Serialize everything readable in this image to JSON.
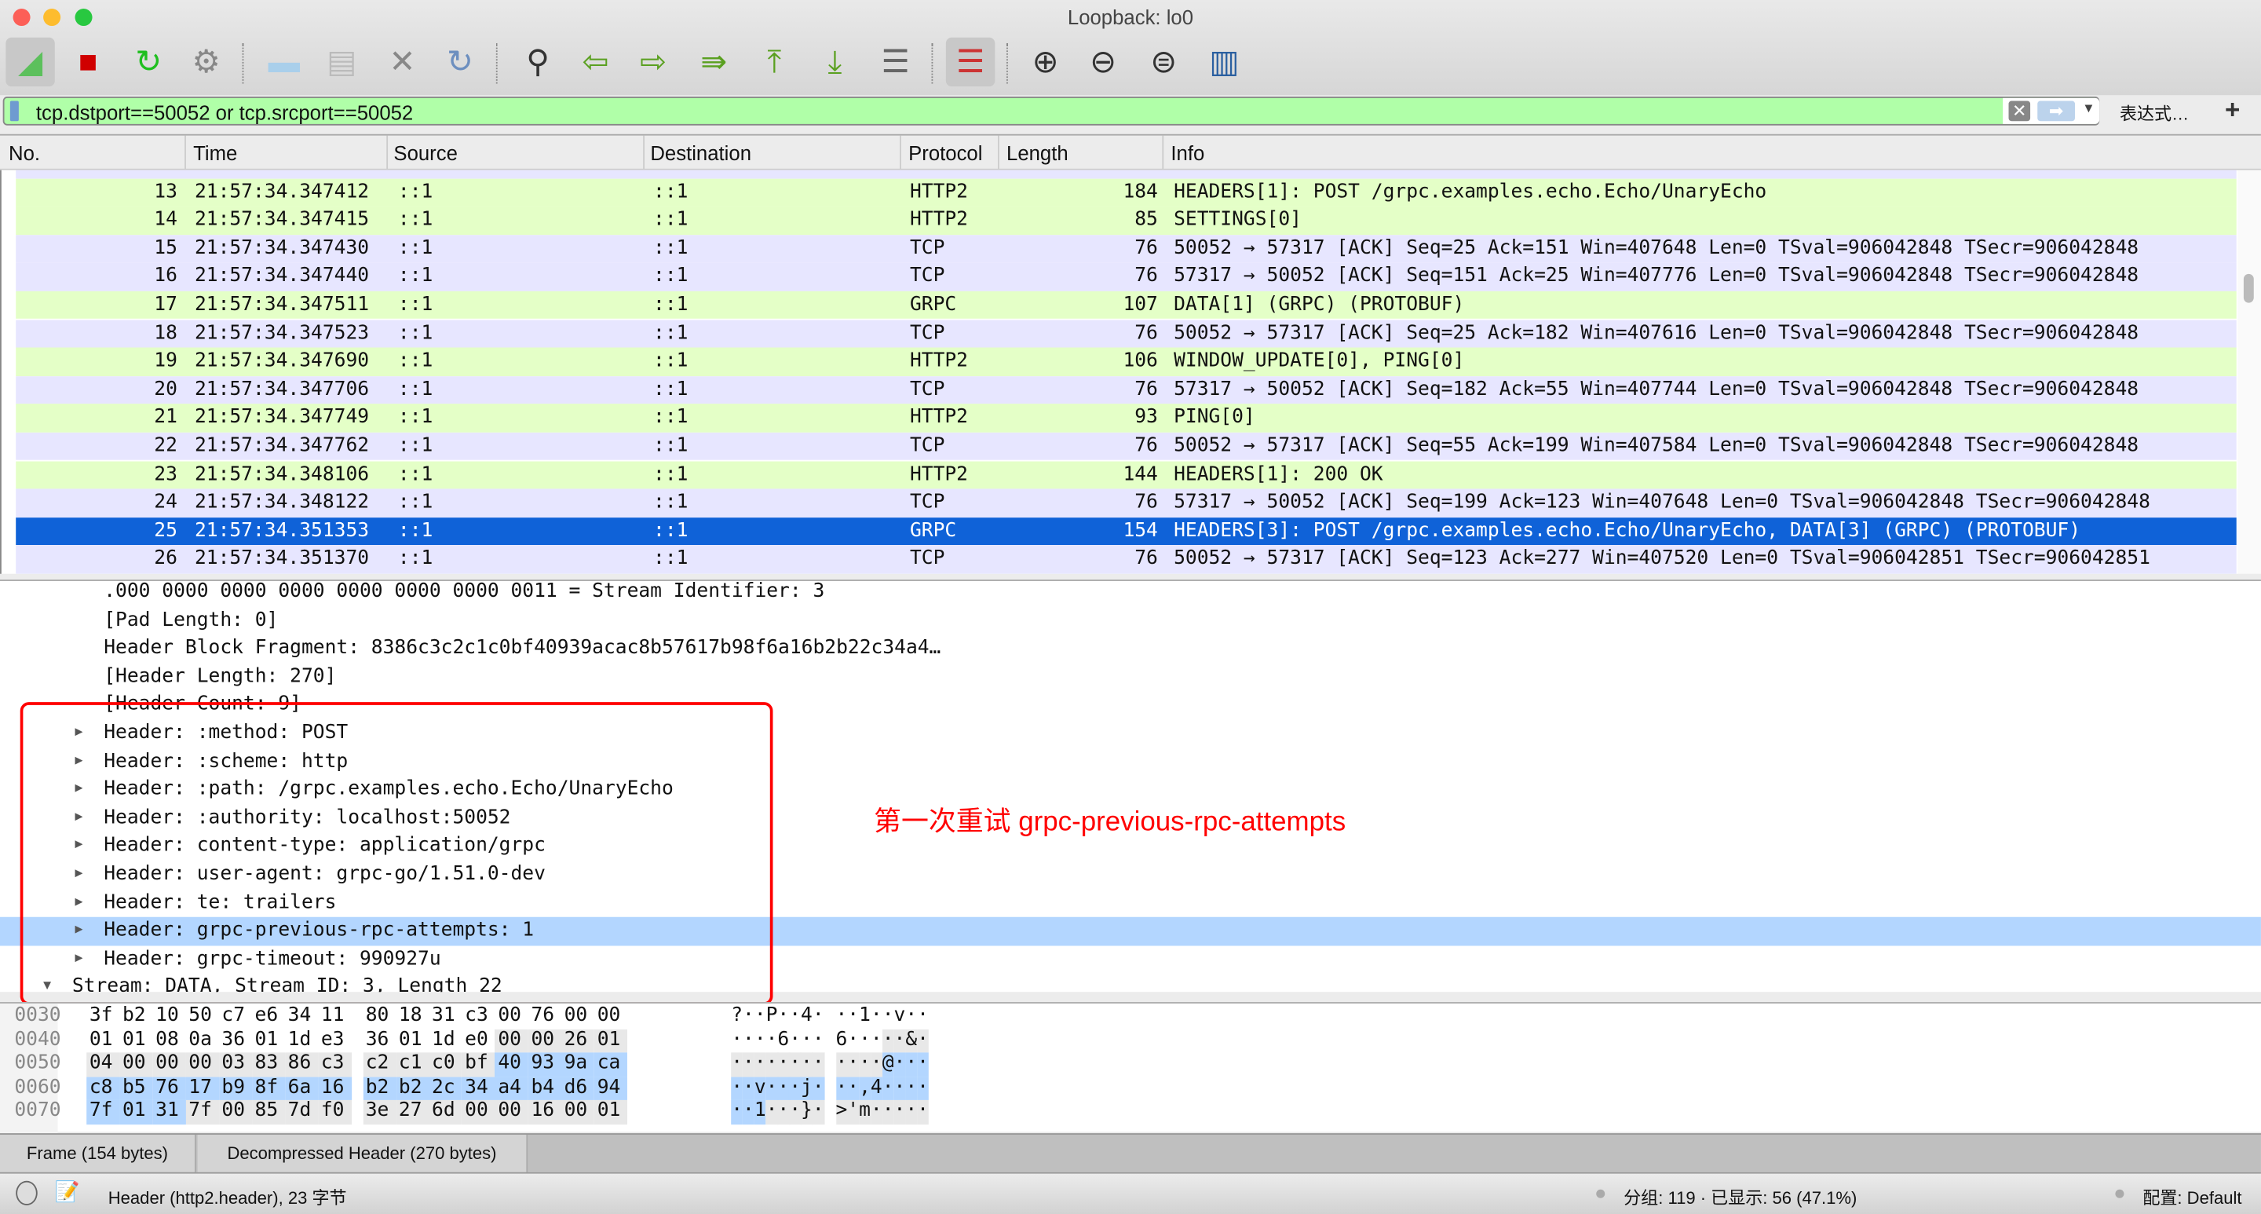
{
  "window": {
    "title": "Loopback: lo0"
  },
  "toolbar": [
    {
      "name": "start-capture-icon",
      "glyph": "◢",
      "color": "#5cc05c",
      "active": true
    },
    {
      "name": "stop-capture-icon",
      "glyph": "■",
      "color": "#d00000"
    },
    {
      "name": "restart-capture-icon",
      "glyph": "↻",
      "color": "#1fbf1f"
    },
    {
      "name": "capture-options-icon",
      "glyph": "⚙",
      "color": "#888"
    },
    {
      "name": "open-file-icon",
      "glyph": "▬",
      "color": "#a9cfeb"
    },
    {
      "name": "save-file-icon",
      "glyph": "▤",
      "color": "#bbb"
    },
    {
      "name": "close-file-icon",
      "glyph": "✕",
      "color": "#888"
    },
    {
      "name": "reload-file-icon",
      "glyph": "↻",
      "color": "#6d8fbf"
    },
    {
      "name": "find-packet-icon",
      "glyph": "⚲",
      "color": "#333"
    },
    {
      "name": "go-back-icon",
      "glyph": "⇦",
      "color": "#5aa020"
    },
    {
      "name": "go-forward-icon",
      "glyph": "⇨",
      "color": "#5aa020"
    },
    {
      "name": "go-to-packet-icon",
      "glyph": "⇛",
      "color": "#5aa020"
    },
    {
      "name": "go-first-packet-icon",
      "glyph": "⤒",
      "color": "#5aa020"
    },
    {
      "name": "go-last-packet-icon",
      "glyph": "⤓",
      "color": "#5aa020"
    },
    {
      "name": "auto-scroll-icon",
      "glyph": "☰",
      "color": "#666"
    },
    {
      "name": "colorize-icon",
      "glyph": "☰",
      "color": "#c33",
      "active": true
    },
    {
      "name": "zoom-in-icon",
      "glyph": "⊕",
      "color": "#333"
    },
    {
      "name": "zoom-out-icon",
      "glyph": "⊖",
      "color": "#333"
    },
    {
      "name": "zoom-reset-icon",
      "glyph": "⊜",
      "color": "#333"
    },
    {
      "name": "resize-columns-icon",
      "glyph": "▥",
      "color": "#2a5fa0"
    }
  ],
  "filter": {
    "value": "tcp.dstport==50052 or tcp.srcport==50052",
    "expression_label": "表达式…",
    "add_label": "+"
  },
  "columns": [
    "No.",
    "Time",
    "Source",
    "Destination",
    "Protocol",
    "Length",
    "Info"
  ],
  "packets": [
    {
      "no": "13",
      "time": "21:57:34.347412",
      "src": "::1",
      "dst": "::1",
      "proto": "HTTP2",
      "len": "184",
      "info": "HEADERS[1]: POST /grpc.examples.echo.Echo/UnaryEcho",
      "color": "g"
    },
    {
      "no": "14",
      "time": "21:57:34.347415",
      "src": "::1",
      "dst": "::1",
      "proto": "HTTP2",
      "len": "85",
      "info": "SETTINGS[0]",
      "color": "g"
    },
    {
      "no": "15",
      "time": "21:57:34.347430",
      "src": "::1",
      "dst": "::1",
      "proto": "TCP",
      "len": "76",
      "info": "50052 → 57317 [ACK] Seq=25 Ack=151 Win=407648 Len=0 TSval=906042848 TSecr=906042848",
      "color": "t"
    },
    {
      "no": "16",
      "time": "21:57:34.347440",
      "src": "::1",
      "dst": "::1",
      "proto": "TCP",
      "len": "76",
      "info": "57317 → 50052 [ACK] Seq=151 Ack=25 Win=407776 Len=0 TSval=906042848 TSecr=906042848",
      "color": "t"
    },
    {
      "no": "17",
      "time": "21:57:34.347511",
      "src": "::1",
      "dst": "::1",
      "proto": "GRPC",
      "len": "107",
      "info": "DATA[1] (GRPC) (PROTOBUF)",
      "color": "g"
    },
    {
      "no": "18",
      "time": "21:57:34.347523",
      "src": "::1",
      "dst": "::1",
      "proto": "TCP",
      "len": "76",
      "info": "50052 → 57317 [ACK] Seq=25 Ack=182 Win=407616 Len=0 TSval=906042848 TSecr=906042848",
      "color": "t"
    },
    {
      "no": "19",
      "time": "21:57:34.347690",
      "src": "::1",
      "dst": "::1",
      "proto": "HTTP2",
      "len": "106",
      "info": "WINDOW_UPDATE[0], PING[0]",
      "color": "g"
    },
    {
      "no": "20",
      "time": "21:57:34.347706",
      "src": "::1",
      "dst": "::1",
      "proto": "TCP",
      "len": "76",
      "info": "57317 → 50052 [ACK] Seq=182 Ack=55 Win=407744 Len=0 TSval=906042848 TSecr=906042848",
      "color": "t"
    },
    {
      "no": "21",
      "time": "21:57:34.347749",
      "src": "::1",
      "dst": "::1",
      "proto": "HTTP2",
      "len": "93",
      "info": "PING[0]",
      "color": "g"
    },
    {
      "no": "22",
      "time": "21:57:34.347762",
      "src": "::1",
      "dst": "::1",
      "proto": "TCP",
      "len": "76",
      "info": "50052 → 57317 [ACK] Seq=55 Ack=199 Win=407584 Len=0 TSval=906042848 TSecr=906042848",
      "color": "t"
    },
    {
      "no": "23",
      "time": "21:57:34.348106",
      "src": "::1",
      "dst": "::1",
      "proto": "HTTP2",
      "len": "144",
      "info": "HEADERS[1]: 200 OK",
      "color": "g"
    },
    {
      "no": "24",
      "time": "21:57:34.348122",
      "src": "::1",
      "dst": "::1",
      "proto": "TCP",
      "len": "76",
      "info": "57317 → 50052 [ACK] Seq=199 Ack=123 Win=407648 Len=0 TSval=906042848 TSecr=906042848",
      "color": "t"
    },
    {
      "no": "25",
      "time": "21:57:34.351353",
      "src": "::1",
      "dst": "::1",
      "proto": "GRPC",
      "len": "154",
      "info": "HEADERS[3]: POST /grpc.examples.echo.Echo/UnaryEcho, DATA[3] (GRPC) (PROTOBUF)",
      "color": "sel"
    },
    {
      "no": "26",
      "time": "21:57:34.351370",
      "src": "::1",
      "dst": "::1",
      "proto": "TCP",
      "len": "76",
      "info": "50052 → 57317 [ACK] Seq=123 Ack=277 Win=407520 Len=0 TSval=906042851 TSecr=906042851",
      "color": "t"
    }
  ],
  "details": [
    {
      "text": ".000 0000 0000 0000 0000 0000 0000 0011 = Stream Identifier: 3",
      "indent": 72
    },
    {
      "text": "[Pad Length: 0]",
      "indent": 72
    },
    {
      "text": "Header Block Fragment: 8386c3c2c1c0bf40939acac8b57617b98f6a16b2b22c34a4…",
      "indent": 72
    },
    {
      "text": "[Header Length: 270]",
      "indent": 72
    },
    {
      "text": "[Header Count: 9]",
      "indent": 72
    },
    {
      "text": "Header: :method: POST",
      "indent": 72,
      "arrow": "▶"
    },
    {
      "text": "Header: :scheme: http",
      "indent": 72,
      "arrow": "▶"
    },
    {
      "text": "Header: :path: /grpc.examples.echo.Echo/UnaryEcho",
      "indent": 72,
      "arrow": "▶"
    },
    {
      "text": "Header: :authority: localhost:50052",
      "indent": 72,
      "arrow": "▶"
    },
    {
      "text": "Header: content-type: application/grpc",
      "indent": 72,
      "arrow": "▶"
    },
    {
      "text": "Header: user-agent: grpc-go/1.51.0-dev",
      "indent": 72,
      "arrow": "▶"
    },
    {
      "text": "Header: te: trailers",
      "indent": 72,
      "arrow": "▶"
    },
    {
      "text": "Header: grpc-previous-rpc-attempts: 1",
      "indent": 72,
      "arrow": "▶",
      "selected": true
    },
    {
      "text": "Header: grpc-timeout: 990927u",
      "indent": 72,
      "arrow": "▶"
    },
    {
      "text": "Stream: DATA, Stream ID: 3, Length 22",
      "indent": 50,
      "arrow": "▼"
    }
  ],
  "annotation": "第一次重试 grpc-previous-rpc-attempts",
  "hex": {
    "lines": [
      {
        "offset": "0030",
        "bytes": "3f b2 10 50 c7 e6 34 11 80 18 31 c3 00 76 00 00",
        "ascii": "?··P··4· ··1··v··"
      },
      {
        "offset": "0040",
        "bytes": "01 01 08 0a 36 01 1d e3 36 01 1d e0 00 00 26 01",
        "ascii": "····6··· 6·····&·"
      },
      {
        "offset": "0050",
        "bytes": "04 00 00 00 03 83 86 c3 c2 c1 c0 bf 40 93 9a ca",
        "ascii": "········ ····@···"
      },
      {
        "offset": "0060",
        "bytes": "c8 b5 76 17 b9 8f 6a 16 b2 b2 2c 34 a4 b4 d6 94",
        "ascii": "··v···j· ··,4····"
      },
      {
        "offset": "0070",
        "bytes": "7f 01 31 7f 00 85 7d f0 3e 27 6d 00 00 16 00 01",
        "ascii": "··1···}· >'m·····"
      }
    ],
    "field_range": {
      "start": 76,
      "end": 127
    },
    "selected_range": {
      "start": 92,
      "end": 114
    }
  },
  "tabs": [
    "Frame (154 bytes)",
    "Decompressed Header (270 bytes)"
  ],
  "status": {
    "field": "Header (http2.header), 23 字节",
    "packets": "分组: 119 · 已显示: 56 (47.1%)",
    "profile": "配置: Default"
  }
}
